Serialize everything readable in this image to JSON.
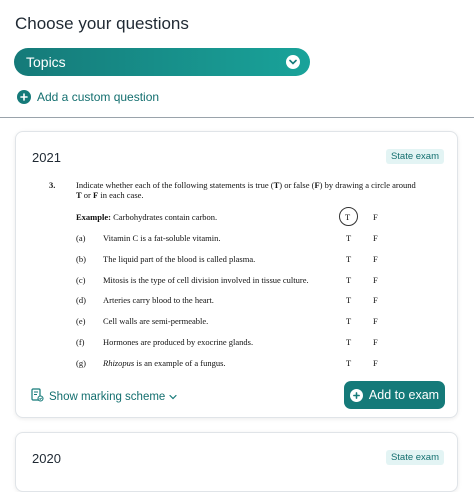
{
  "page": {
    "title": "Choose your questions"
  },
  "topics": {
    "label": "Topics",
    "icon": "chevron-down-icon"
  },
  "add_custom": {
    "label": "Add a custom question",
    "icon": "plus-circle-icon"
  },
  "cards": [
    {
      "year": "2021",
      "badge": "State exam",
      "question": {
        "number": "3.",
        "text": "Indicate whether each of the following statements is true (T) or false (F) by drawing a circle around T or F in each case.",
        "example": {
          "label": "Example:",
          "text": "Carbohydrates contain carbon.",
          "t": "T",
          "f": "F"
        },
        "rows": [
          {
            "letter": "(a)",
            "text": "Vitamin C is a fat-soluble vitamin.",
            "t": "T",
            "f": "F"
          },
          {
            "letter": "(b)",
            "text": "The liquid part of the blood is called plasma.",
            "t": "T",
            "f": "F"
          },
          {
            "letter": "(c)",
            "text": "Mitosis is the type of cell division involved in tissue culture.",
            "t": "T",
            "f": "F"
          },
          {
            "letter": "(d)",
            "text": "Arteries carry blood to the heart.",
            "t": "T",
            "f": "F"
          },
          {
            "letter": "(e)",
            "text": "Cell walls are semi-permeable.",
            "t": "T",
            "f": "F"
          },
          {
            "letter": "(f)",
            "text": "Hormones are produced by exocrine glands.",
            "t": "T",
            "f": "F"
          },
          {
            "letter": "(g)",
            "text_italic": "Rhizopus",
            "text": " is an example of a fungus.",
            "t": "T",
            "f": "F"
          }
        ]
      },
      "marking_label": "Show marking scheme",
      "add_label": "Add to exam"
    },
    {
      "year": "2020",
      "badge": "State exam"
    }
  ],
  "colors": {
    "teal": "#157a79",
    "teal_light": "#19a39a",
    "badge_bg": "#e3f4f4"
  }
}
